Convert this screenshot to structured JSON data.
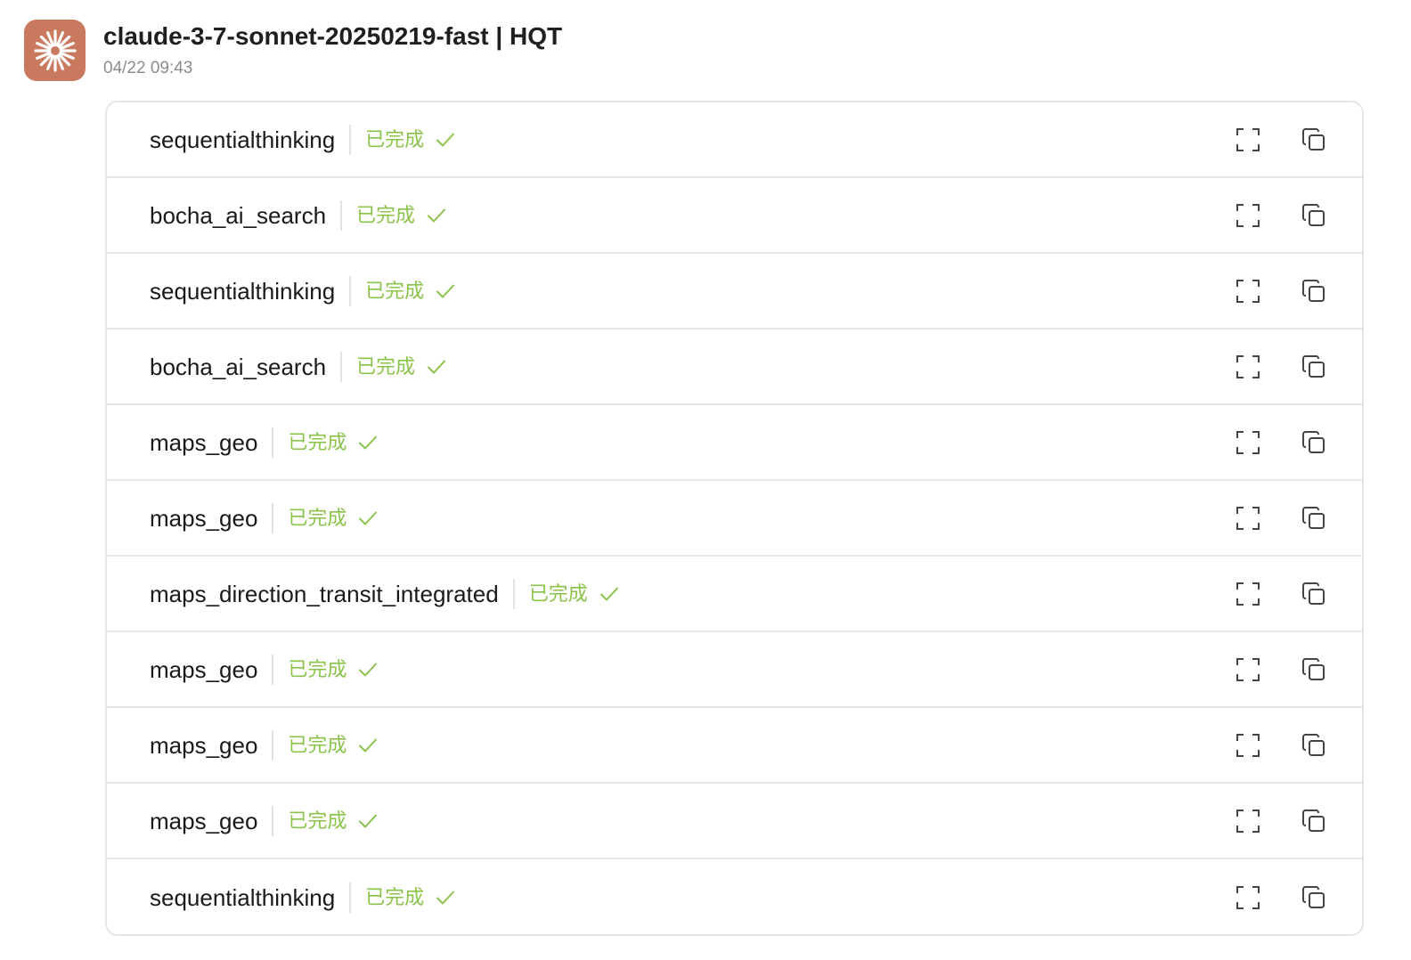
{
  "header": {
    "model_name": "claude-3-7-sonnet-20250219-fast | HQT",
    "timestamp": "04/22 09:43"
  },
  "colors": {
    "avatar_bg": "#c97a5e",
    "status_green": "#8bc34a",
    "border": "#e6e6e6"
  },
  "icons": {
    "avatar": "sparkle-burst-icon",
    "status": "check-icon",
    "expand": "fullscreen-expand-icon",
    "copy": "copy-icon"
  },
  "tools": [
    {
      "name": "sequentialthinking",
      "status": "已完成"
    },
    {
      "name": "bocha_ai_search",
      "status": "已完成"
    },
    {
      "name": "sequentialthinking",
      "status": "已完成"
    },
    {
      "name": "bocha_ai_search",
      "status": "已完成"
    },
    {
      "name": "maps_geo",
      "status": "已完成"
    },
    {
      "name": "maps_geo",
      "status": "已完成"
    },
    {
      "name": "maps_direction_transit_integrated",
      "status": "已完成"
    },
    {
      "name": "maps_geo",
      "status": "已完成"
    },
    {
      "name": "maps_geo",
      "status": "已完成"
    },
    {
      "name": "maps_geo",
      "status": "已完成"
    },
    {
      "name": "sequentialthinking",
      "status": "已完成"
    }
  ]
}
